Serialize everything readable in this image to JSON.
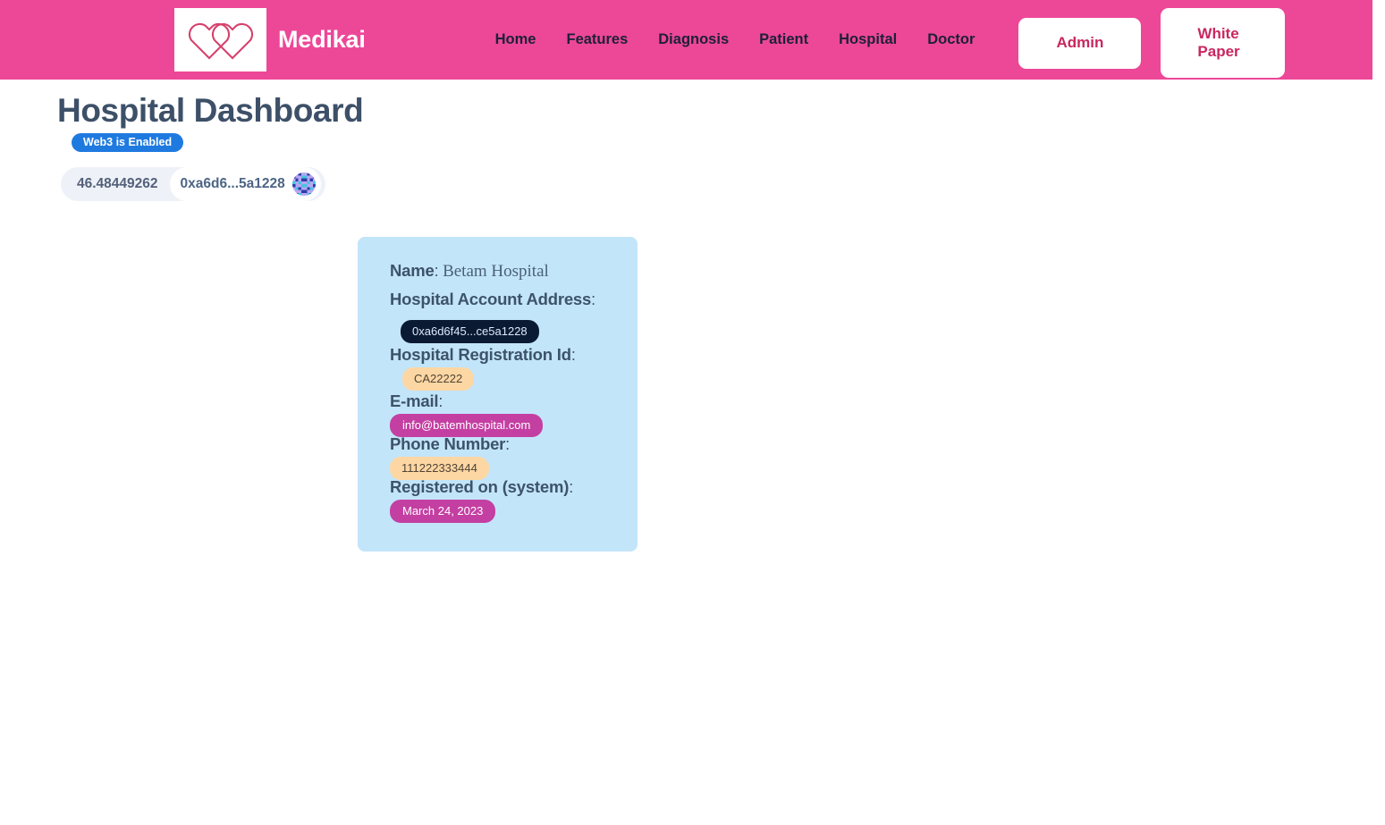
{
  "header": {
    "brand_name": "Medikai",
    "logo_icon": "interlocking-hearts-logo",
    "nav_links": [
      {
        "label": "Home"
      },
      {
        "label": "Features"
      },
      {
        "label": "Diagnosis"
      },
      {
        "label": "Patient"
      },
      {
        "label": "Hospital"
      },
      {
        "label": "Doctor"
      }
    ],
    "admin_button": "Admin",
    "white_paper_button_line1": "White",
    "white_paper_button_line2": "Paper",
    "background_color": "#ed4798",
    "button_text_color": "#c9275f"
  },
  "page": {
    "title": "Hospital Dashboard",
    "web3_badge": "Web3 is Enabled",
    "web3_badge_color": "#1f7ae0",
    "title_color": "#3d5068"
  },
  "wallet": {
    "balance": "46.48449262",
    "address_short": "0xa6d6...5a1228",
    "identicon_icon": "blockies-identicon",
    "pill_background": "#eef2f8"
  },
  "hospital_card": {
    "background_color": "#c3e5fa",
    "name_label": "Name",
    "name_colon": ":",
    "name_value": "Betam Hospital",
    "account_address_label": "Hospital Account Address",
    "account_address_colon": ":",
    "account_address_value": "0xa6d6f45...ce5a1228",
    "account_address_badge_color": "#0b1a33",
    "registration_id_label": "Hospital Registration Id",
    "registration_id_colon": ":",
    "registration_id_value": "CA22222",
    "registration_id_badge_color": "#fcd7a4",
    "email_label": "E-mail",
    "email_colon": ":",
    "email_value": "info@batemhospital.com",
    "email_badge_color": "#c43fa2",
    "phone_label": "Phone Number",
    "phone_colon": ":",
    "phone_value": "111222333444",
    "phone_badge_color": "#fcd7a4",
    "registered_on_label": "Registered on (system)",
    "registered_on_colon": ":",
    "registered_on_value": "March 24, 2023",
    "registered_on_badge_color": "#c43fa2"
  }
}
